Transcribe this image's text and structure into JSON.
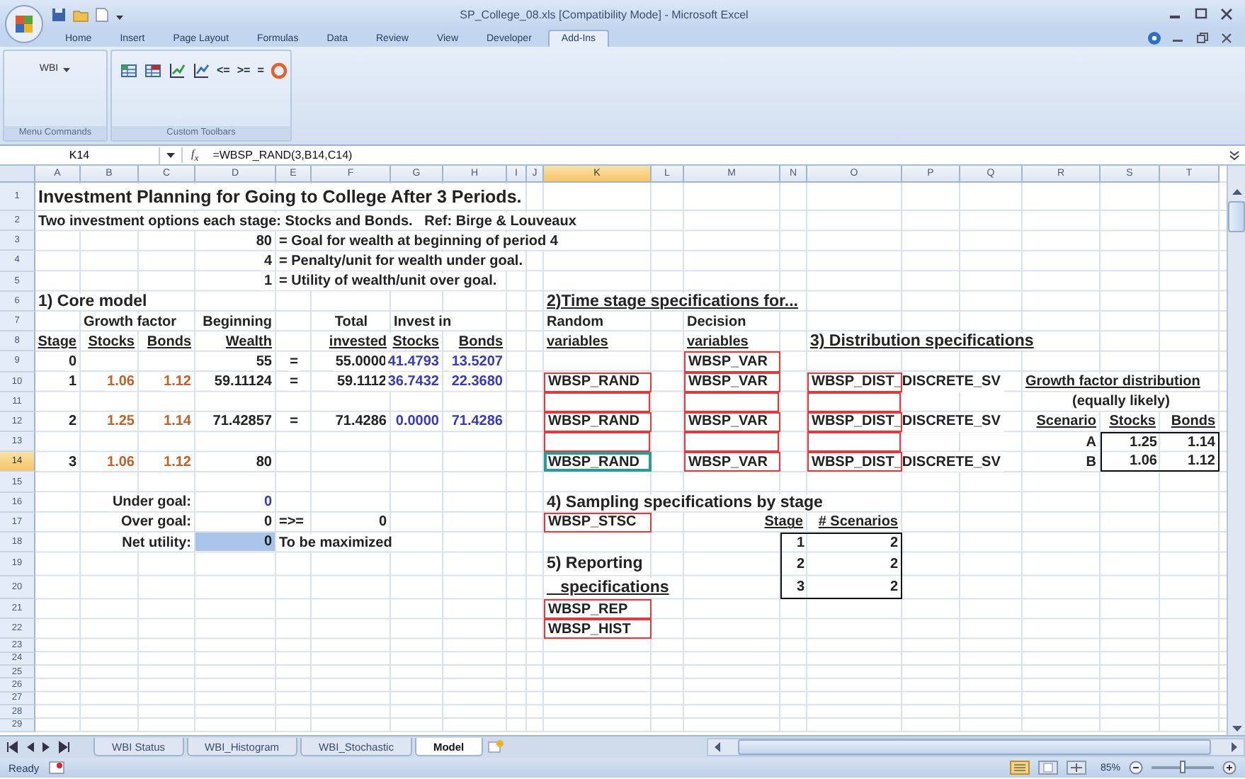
{
  "window": {
    "title": "SP_College_08.xls  [Compatibility Mode] - Microsoft Excel"
  },
  "ribbon_tabs": [
    {
      "label": "Home",
      "selected": false
    },
    {
      "label": "Insert",
      "selected": false
    },
    {
      "label": "Page Layout",
      "selected": false
    },
    {
      "label": "Formulas",
      "selected": false
    },
    {
      "label": "Data",
      "selected": false
    },
    {
      "label": "Review",
      "selected": false
    },
    {
      "label": "View",
      "selected": false
    },
    {
      "label": "Developer",
      "selected": false
    },
    {
      "label": "Add-Ins",
      "selected": true
    }
  ],
  "ribbon_groups": [
    {
      "label": "Menu Commands",
      "items": [
        {
          "kind": "dropdown",
          "label": "WBI"
        }
      ]
    },
    {
      "label": "Custom Toolbars",
      "items": [
        {
          "kind": "icon"
        },
        {
          "kind": "icon"
        },
        {
          "kind": "icon"
        },
        {
          "kind": "icon"
        },
        {
          "kind": "glyph",
          "label": "<="
        },
        {
          "kind": "glyph",
          "label": ">="
        },
        {
          "kind": "glyph",
          "label": "="
        },
        {
          "kind": "icon"
        }
      ]
    }
  ],
  "formula_bar": {
    "name_box": "K14",
    "function_label": "f$_{x}$",
    "formula": "=WBSP_RAND(3,B14,C14)"
  },
  "columns": [
    {
      "header": "A",
      "selected": false
    },
    {
      "header": "B",
      "selected": false
    },
    {
      "header": "C",
      "selected": false
    },
    {
      "header": "D",
      "selected": false
    },
    {
      "header": "E",
      "selected": false
    },
    {
      "header": "F",
      "selected": false
    },
    {
      "header": "G",
      "selected": false
    },
    {
      "header": "H",
      "selected": false
    },
    {
      "header": "I",
      "selected": false
    },
    {
      "header": "J",
      "selected": false
    },
    {
      "header": "K",
      "selected": true
    },
    {
      "header": "L",
      "selected": false
    },
    {
      "header": "M",
      "selected": false
    },
    {
      "header": "N",
      "selected": false
    },
    {
      "header": "O",
      "selected": false
    },
    {
      "header": "P",
      "selected": false
    },
    {
      "header": "Q",
      "selected": false
    },
    {
      "header": "R",
      "selected": false
    },
    {
      "header": "S",
      "selected": false
    },
    {
      "header": "T",
      "selected": false
    }
  ],
  "rows": [
    {
      "header": "1",
      "selected": false,
      "cells": [
        {
          "text": "Investment Planning for Going to College After 3 Periods.",
          "kind": "title"
        }
      ]
    },
    {
      "header": "2",
      "selected": false,
      "cells": [
        {
          "text": "Two investment options each stage: Stocks and Bonds.   Ref: Birge & Louveaux",
          "kind": "text"
        }
      ]
    },
    {
      "header": "3",
      "selected": false,
      "cells": [
        {},
        {},
        {},
        {
          "text": "80",
          "kind": "number"
        },
        {
          "text": "= Goal for wealth at beginning of period 4",
          "kind": "text"
        }
      ]
    },
    {
      "header": "4",
      "selected": false,
      "cells": [
        {},
        {},
        {},
        {
          "text": "4",
          "kind": "number"
        },
        {
          "text": "= Penalty/unit for wealth under goal.",
          "kind": "text"
        }
      ]
    },
    {
      "header": "5",
      "selected": false,
      "cells": [
        {},
        {},
        {},
        {
          "text": "1",
          "kind": "number"
        },
        {
          "text": "= Utility of wealth/unit over goal.",
          "kind": "text"
        }
      ]
    },
    {
      "header": "6",
      "selected": false,
      "cells": [
        {
          "text": "1) Core model",
          "kind": "heading"
        },
        {},
        {},
        {},
        {},
        {},
        {},
        {},
        {},
        {},
        {
          "text": "2)Time stage specifications for...",
          "kind": "heading_u"
        }
      ]
    },
    {
      "header": "7",
      "selected": false,
      "cells": [
        {},
        {
          "text": "Growth factor",
          "kind": "text"
        },
        {},
        {
          "text": "Beginning",
          "kind": "text_right"
        },
        {},
        {
          "text": "Total",
          "kind": "text_center"
        },
        {
          "text": "Invest in",
          "kind": "text"
        },
        {},
        {},
        {},
        {
          "text": "Random",
          "kind": "text"
        },
        {},
        {
          "text": "Decision",
          "kind": "text"
        }
      ]
    },
    {
      "header": "8",
      "selected": false,
      "cells": [
        {
          "text": "Stage",
          "kind": "header"
        },
        {
          "text": "Stocks",
          "kind": "header"
        },
        {
          "text": "Bonds",
          "kind": "header"
        },
        {
          "text": "Wealth",
          "kind": "header"
        },
        {},
        {
          "text": "invested",
          "kind": "header"
        },
        {
          "text": "Stocks",
          "kind": "header"
        },
        {
          "text": "Bonds",
          "kind": "header"
        },
        {},
        {},
        {
          "text": "variables",
          "kind": "header_left"
        },
        {},
        {
          "text": "variables",
          "kind": "header_left"
        },
        {},
        {
          "text": "3) Distribution specifications",
          "kind": "heading_u"
        }
      ]
    },
    {
      "header": "9",
      "selected": false,
      "cells": [
        {
          "text": "0",
          "kind": "number"
        },
        {},
        {},
        {
          "text": "55",
          "kind": "number"
        },
        {
          "text": "=",
          "kind": "text_center"
        },
        {
          "text": "55.0000",
          "kind": "number"
        },
        {
          "text": "41.4793",
          "kind": "decision"
        },
        {
          "text": "13.5207",
          "kind": "decision"
        },
        {},
        {},
        {},
        {},
        {
          "text": "WBSP_VAR",
          "kind": "range"
        }
      ]
    },
    {
      "header": "10",
      "selected": false,
      "cells": [
        {
          "text": "1",
          "kind": "number"
        },
        {
          "text": "1.06",
          "kind": "input"
        },
        {
          "text": "1.12",
          "kind": "input"
        },
        {
          "text": "59.11124",
          "kind": "number"
        },
        {
          "text": "=",
          "kind": "text_center"
        },
        {
          "text": "59.1112",
          "kind": "number"
        },
        {
          "text": "36.7432",
          "kind": "decision"
        },
        {
          "text": "22.3680",
          "kind": "decision"
        },
        {},
        {},
        {
          "text": "WBSP_RAND",
          "kind": "range"
        },
        {},
        {
          "text": "WBSP_VAR",
          "kind": "range"
        },
        {},
        {
          "text": "WBSP_DIST_DISCRETE_SV",
          "kind": "range"
        },
        {},
        {},
        {
          "text": "Growth factor distribution",
          "kind": "header_left"
        }
      ]
    },
    {
      "header": "11",
      "selected": false,
      "cells": [
        {},
        {},
        {},
        {},
        {},
        {},
        {},
        {},
        {},
        {},
        {
          "kind": "range"
        },
        {},
        {
          "kind": "range"
        },
        {},
        {
          "kind": "range"
        },
        {},
        {},
        {
          "text": "(equally likely)",
          "kind": "text_center"
        }
      ]
    },
    {
      "header": "12",
      "selected": false,
      "cells": [
        {
          "text": "2",
          "kind": "number"
        },
        {
          "text": "1.25",
          "kind": "input"
        },
        {
          "text": "1.14",
          "kind": "input"
        },
        {
          "text": "71.42857",
          "kind": "number"
        },
        {
          "text": "=",
          "kind": "text_center"
        },
        {
          "text": "71.4286",
          "kind": "number"
        },
        {
          "text": "0.0000",
          "kind": "decision"
        },
        {
          "text": "71.4286",
          "kind": "decision"
        },
        {},
        {},
        {
          "text": "WBSP_RAND",
          "kind": "range"
        },
        {},
        {
          "text": "WBSP_VAR",
          "kind": "range"
        },
        {},
        {
          "text": "WBSP_DIST_DISCRETE_SV",
          "kind": "range"
        },
        {},
        {},
        {
          "text": "Scenario",
          "kind": "header"
        },
        {
          "text": "Stocks",
          "kind": "header"
        },
        {
          "text": "Bonds",
          "kind": "header"
        }
      ]
    },
    {
      "header": "13",
      "selected": false,
      "cells": [
        {},
        {},
        {},
        {},
        {},
        {},
        {},
        {},
        {},
        {},
        {
          "kind": "range"
        },
        {},
        {
          "kind": "range"
        },
        {},
        {
          "kind": "range"
        },
        {},
        {},
        {
          "text": "A",
          "kind": "number"
        },
        {
          "text": "1.25",
          "kind": "boxed"
        },
        {
          "text": "1.14",
          "kind": "boxed"
        }
      ]
    },
    {
      "header": "14",
      "selected": true,
      "cells": [
        {
          "text": "3",
          "kind": "number"
        },
        {
          "text": "1.06",
          "kind": "input"
        },
        {
          "text": "1.12",
          "kind": "input"
        },
        {
          "text": "80",
          "kind": "number"
        },
        {},
        {},
        {},
        {},
        {},
        {},
        {
          "text": "WBSP_RAND",
          "kind": "range"
        },
        {},
        {
          "text": "WBSP_VAR",
          "kind": "range"
        },
        {},
        {
          "text": "WBSP_DIST_DISCRETE_SV",
          "kind": "range"
        },
        {},
        {},
        {
          "text": "B",
          "kind": "number"
        },
        {
          "text": "1.06",
          "kind": "boxed"
        },
        {
          "text": "1.12",
          "kind": "boxed"
        }
      ]
    },
    {
      "header": "15",
      "selected": false,
      "cells": []
    },
    {
      "header": "16",
      "selected": false,
      "cells": [
        {},
        {},
        {
          "text": "Under goal:",
          "kind": "text_right"
        },
        {
          "text": "0",
          "kind": "decision"
        },
        {},
        {},
        {},
        {},
        {},
        {},
        {
          "text": "4) Sampling specifications by stage",
          "kind": "heading"
        }
      ]
    },
    {
      "header": "17",
      "selected": false,
      "cells": [
        {},
        {},
        {
          "text": "Over goal:",
          "kind": "text_right"
        },
        {
          "text": "0",
          "kind": "number"
        },
        {
          "text": "=>=",
          "kind": "text"
        },
        {
          "text": "0",
          "kind": "number"
        },
        {},
        {},
        {},
        {},
        {
          "text": "WBSP_STSC",
          "kind": "range"
        },
        {},
        {},
        {
          "text": "Stage",
          "kind": "text_right_u"
        },
        {
          "text": "# Scenarios",
          "kind": "header"
        }
      ]
    },
    {
      "header": "18",
      "selected": false,
      "cells": [
        {},
        {},
        {
          "text": "Net utility:",
          "kind": "text_right"
        },
        {
          "text": "0",
          "kind": "objective"
        },
        {
          "text": "To be maximized",
          "kind": "text"
        },
        {},
        {},
        {},
        {},
        {},
        {},
        {},
        {},
        {
          "text": "1",
          "kind": "boxed"
        },
        {
          "text": "2",
          "kind": "boxed"
        }
      ]
    },
    {
      "header": "19",
      "selected": false,
      "cells": [
        {},
        {},
        {},
        {},
        {},
        {},
        {},
        {},
        {},
        {},
        {
          "text": "5) Reporting",
          "kind": "heading"
        },
        {},
        {},
        {
          "text": "2",
          "kind": "boxed"
        },
        {
          "text": "2",
          "kind": "boxed"
        }
      ]
    },
    {
      "header": "20",
      "selected": false,
      "cells": [
        {},
        {},
        {},
        {},
        {},
        {},
        {},
        {},
        {},
        {},
        {
          "text": "   specifications",
          "kind": "heading_u"
        },
        {},
        {},
        {
          "text": "3",
          "kind": "boxed"
        },
        {
          "text": "2",
          "kind": "boxed"
        }
      ]
    },
    {
      "header": "21",
      "selected": false,
      "cells": [
        {},
        {},
        {},
        {},
        {},
        {},
        {},
        {},
        {},
        {},
        {
          "text": "WBSP_REP",
          "kind": "range"
        }
      ]
    },
    {
      "header": "22",
      "selected": false,
      "cells": [
        {},
        {},
        {},
        {},
        {},
        {},
        {},
        {},
        {},
        {},
        {
          "text": "WBSP_HIST",
          "kind": "range"
        }
      ]
    },
    {
      "header": "23",
      "selected": false,
      "cells": []
    },
    {
      "header": "24",
      "selected": false,
      "cells": []
    },
    {
      "header": "25",
      "selected": false,
      "cells": []
    },
    {
      "header": "26",
      "selected": false,
      "cells": []
    },
    {
      "header": "27",
      "selected": false,
      "cells": []
    },
    {
      "header": "28",
      "selected": false,
      "cells": []
    },
    {
      "header": "29",
      "selected": false,
      "cells": []
    }
  ],
  "sheet_tabs": [
    {
      "label": "WBI Status",
      "selected": false
    },
    {
      "label": "WBI_Histogram",
      "selected": false
    },
    {
      "label": "WBI_Stochastic",
      "selected": false
    },
    {
      "label": "Model",
      "selected": true
    }
  ],
  "status_bar": {
    "status": "Ready",
    "zoom": "85%",
    "zoom_slider": {
      "level": 0.5
    }
  }
}
